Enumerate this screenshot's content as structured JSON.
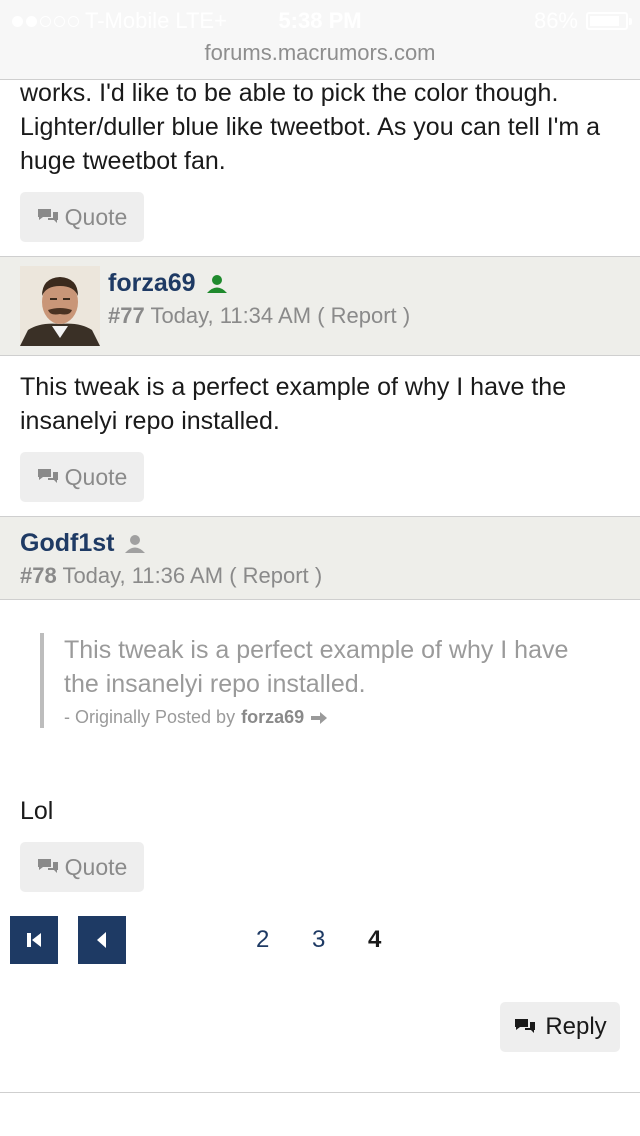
{
  "status_bar": {
    "carrier": "T-Mobile",
    "network": "LTE+",
    "time": "5:38 PM",
    "battery_percent": "86%",
    "battery_level": 0.86,
    "signal_bars": 2
  },
  "browser": {
    "url": "forums.macrumors.com"
  },
  "colors": {
    "accent": "#1e3a64",
    "online": "#1f8a2d",
    "offline": "#a0a0a0"
  },
  "posts": [
    {
      "text": "works. I'd like to be able to pick the color though. Lighter/duller blue like tweetbot. As you can tell I'm a huge tweetbot fan.",
      "quote_label": "Quote"
    },
    {
      "username": "forza69",
      "status_icon": "online-user-icon",
      "number": "#77",
      "time": "Today, 11:34 AM",
      "report_open": "(",
      "report_label": "Report",
      "report_close": ")",
      "text": "This tweak is a perfect example of why I have the insanelyi repo installed.",
      "quote_label": "Quote"
    },
    {
      "username": "Godf1st",
      "status_icon": "offline-user-icon",
      "number": "#78",
      "time": "Today, 11:36 AM",
      "report_open": "(",
      "report_label": "Report",
      "report_close": ")",
      "blockquote": {
        "text": "This tweak is a perfect example of why I have the insanelyi repo installed.",
        "attribution_prefix": "- Originally Posted by",
        "attribution_user": "forza69"
      },
      "text": "Lol",
      "quote_label": "Quote"
    }
  ],
  "pagination": {
    "pages": [
      "2",
      "3",
      "4"
    ],
    "current": "4"
  },
  "reply_label": "Reply"
}
